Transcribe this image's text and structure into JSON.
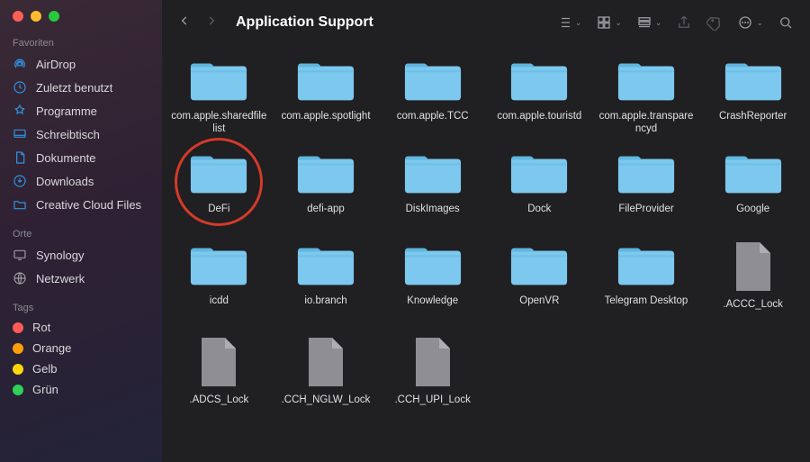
{
  "window": {
    "title": "Application Support"
  },
  "sidebar": {
    "sections": {
      "favorites": {
        "title": "Favoriten",
        "items": [
          {
            "label": "AirDrop"
          },
          {
            "label": "Zuletzt benutzt"
          },
          {
            "label": "Programme"
          },
          {
            "label": "Schreibtisch"
          },
          {
            "label": "Dokumente"
          },
          {
            "label": "Downloads"
          },
          {
            "label": "Creative Cloud Files"
          }
        ]
      },
      "locations": {
        "title": "Orte",
        "items": [
          {
            "label": "Synology"
          },
          {
            "label": "Netzwerk"
          }
        ]
      },
      "tags": {
        "title": "Tags",
        "items": [
          {
            "label": "Rot",
            "color": "#ff5b56"
          },
          {
            "label": "Orange",
            "color": "#ff9f0a"
          },
          {
            "label": "Gelb",
            "color": "#ffd60a"
          },
          {
            "label": "Grün",
            "color": "#30d158"
          }
        ]
      }
    }
  },
  "items": [
    {
      "name": "com.apple.sharedfilelist",
      "kind": "folder"
    },
    {
      "name": "com.apple.spotlight",
      "kind": "folder"
    },
    {
      "name": "com.apple.TCC",
      "kind": "folder"
    },
    {
      "name": "com.apple.touristd",
      "kind": "folder"
    },
    {
      "name": "com.apple.transparencyd",
      "kind": "folder"
    },
    {
      "name": "CrashReporter",
      "kind": "folder"
    },
    {
      "name": "DeFi",
      "kind": "folder",
      "highlighted": true
    },
    {
      "name": "defi-app",
      "kind": "folder"
    },
    {
      "name": "DiskImages",
      "kind": "folder"
    },
    {
      "name": "Dock",
      "kind": "folder"
    },
    {
      "name": "FileProvider",
      "kind": "folder"
    },
    {
      "name": "Google",
      "kind": "folder"
    },
    {
      "name": "icdd",
      "kind": "folder"
    },
    {
      "name": "io.branch",
      "kind": "folder"
    },
    {
      "name": "Knowledge",
      "kind": "folder"
    },
    {
      "name": "OpenVR",
      "kind": "folder"
    },
    {
      "name": "Telegram Desktop",
      "kind": "folder"
    },
    {
      "name": ".ACCC_Lock",
      "kind": "file"
    },
    {
      "name": ".ADCS_Lock",
      "kind": "file"
    },
    {
      "name": ".CCH_NGLW_Lock",
      "kind": "file"
    },
    {
      "name": ".CCH_UPI_Lock",
      "kind": "file"
    }
  ],
  "colors": {
    "folder": "#7cc8ee",
    "folderTab": "#5fb6e0",
    "file": "#8e8e93"
  }
}
